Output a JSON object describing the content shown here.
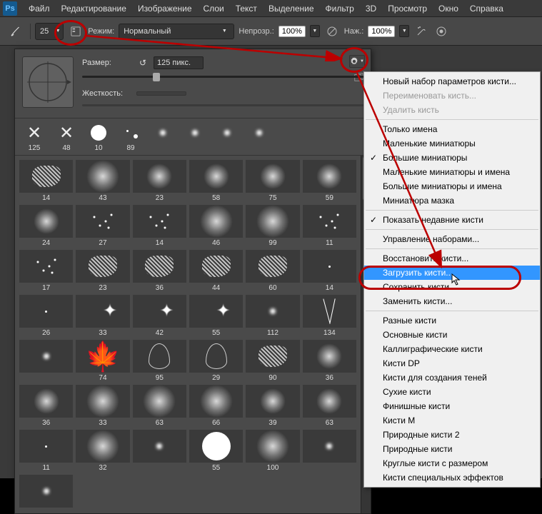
{
  "menu": [
    "Файл",
    "Редактирование",
    "Изображение",
    "Слои",
    "Текст",
    "Выделение",
    "Фильтр",
    "3D",
    "Просмотр",
    "Окно",
    "Справка"
  ],
  "optbar": {
    "size": "25",
    "mode_label": "Режим:",
    "mode_value": "Нормальный",
    "opacity_label": "Непрозр.:",
    "opacity_value": "100%",
    "flow_label": "Наж.:",
    "flow_value": "100%"
  },
  "brush_panel": {
    "size_label": "Размер:",
    "size_value": "125 пикс.",
    "hardness_label": "Жесткость:"
  },
  "top_brushes": [
    "125",
    "48",
    "10",
    "89",
    "",
    "",
    "",
    ""
  ],
  "grid_brushes": [
    [
      "14",
      "43",
      "23",
      "58",
      "75",
      "59",
      "24"
    ],
    [
      "27",
      "14",
      "46",
      "99",
      "11",
      "17"
    ],
    [
      "23",
      "36",
      "44",
      "60",
      "14",
      "26"
    ],
    [
      "33",
      "42",
      "55",
      "112",
      "134",
      ""
    ],
    [
      "74",
      "95",
      "29",
      "90",
      "36",
      "36"
    ],
    [
      "33",
      "63",
      "66",
      "39",
      "63",
      "11"
    ],
    [
      "32",
      "",
      "55",
      "100",
      "",
      ""
    ]
  ],
  "context_menu": {
    "s1": [
      "Новый набор параметров кисти..."
    ],
    "s1_disabled": [
      "Переименовать кисть...",
      "Удалить кисть"
    ],
    "s2": [
      {
        "t": "Только имена",
        "c": false
      },
      {
        "t": "Маленькие миниатюры",
        "c": false
      },
      {
        "t": "Большие миниатюры",
        "c": true
      },
      {
        "t": "Маленькие миниатюры и имена",
        "c": false
      },
      {
        "t": "Большие миниатюры и имена",
        "c": false
      },
      {
        "t": "Миниатюра мазка",
        "c": false
      }
    ],
    "s3": [
      {
        "t": "Показать недавние кисти",
        "c": true
      }
    ],
    "s4": [
      "Управление наборами..."
    ],
    "s5": [
      "Восстановить кисти...",
      "Загрузить кисти...",
      "Сохранить кисти...",
      "Заменить кисти..."
    ],
    "s5_highlight": 1,
    "s6": [
      "Разные кисти",
      "Основные кисти",
      "Каллиграфические кисти",
      "Кисти DP",
      "Кисти для создания теней",
      "Сухие кисти",
      "Финишные кисти",
      "Кисти М",
      "Природные кисти 2",
      "Природные кисти",
      "Круглые кисти с размером",
      "Кисти специальных эффектов"
    ]
  }
}
